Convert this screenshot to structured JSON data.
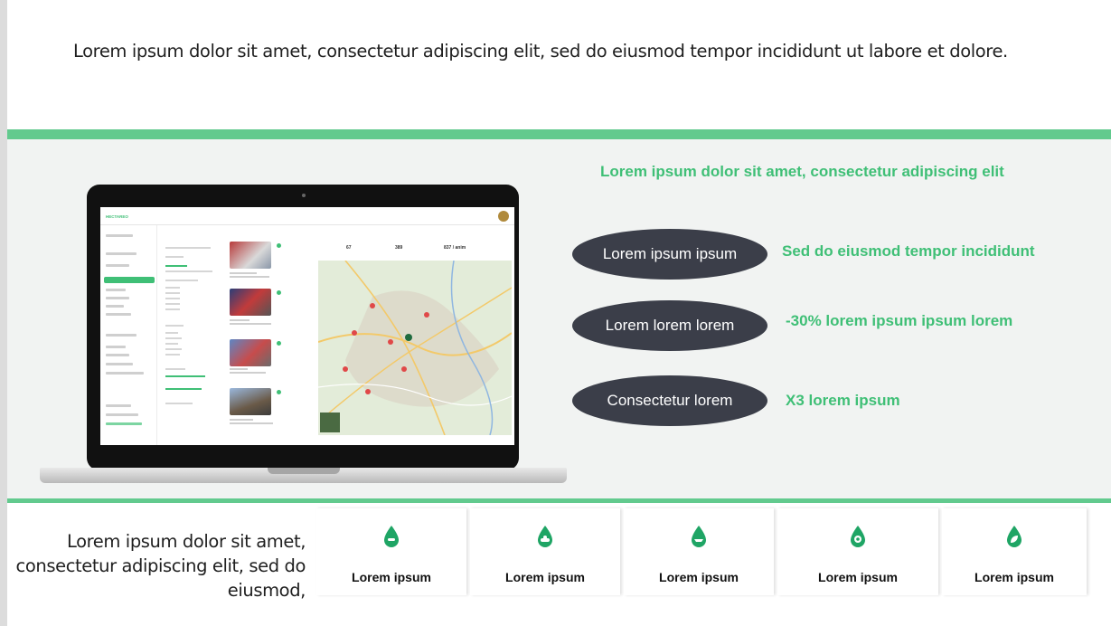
{
  "intro_text": "Lorem ipsum dolor sit amet, consectetur adipiscing elit, sed do eiusmod tempor incididunt ut labore et dolore.",
  "features": {
    "title": "Lorem ipsum dolor sit amet, consectetur adipiscing elit",
    "rows": [
      {
        "pill": "Lorem ipsum ipsum",
        "text": "Sed do eiusmod tempor incididunt"
      },
      {
        "pill": "Lorem lorem lorem",
        "text": "-30% lorem ipsum ipsum lorem"
      },
      {
        "pill": "Consectetur lorem",
        "text": "X3 lorem ipsum"
      }
    ]
  },
  "app_preview": {
    "logo": "HECTAREO",
    "stats": [
      "67",
      "389",
      "837 / anim"
    ]
  },
  "bottom_text": "Lorem ipsum dolor sit amet, consectetur adipiscing elit, sed do eiusmod,",
  "tiles": [
    {
      "label": "Lorem ipsum",
      "icon": "drop-face-icon"
    },
    {
      "label": "Lorem ipsum",
      "icon": "drop-car-icon"
    },
    {
      "label": "Lorem ipsum",
      "icon": "drop-boat-icon"
    },
    {
      "label": "Lorem ipsum",
      "icon": "drop-gear-icon"
    },
    {
      "label": "Lorem ipsum",
      "icon": "drop-leaf-icon"
    }
  ],
  "colors": {
    "accent_green": "#3fbf76",
    "band_border": "#62ca8e",
    "pill_bg": "#3b3e49",
    "tile_icon": "#1fa565"
  }
}
